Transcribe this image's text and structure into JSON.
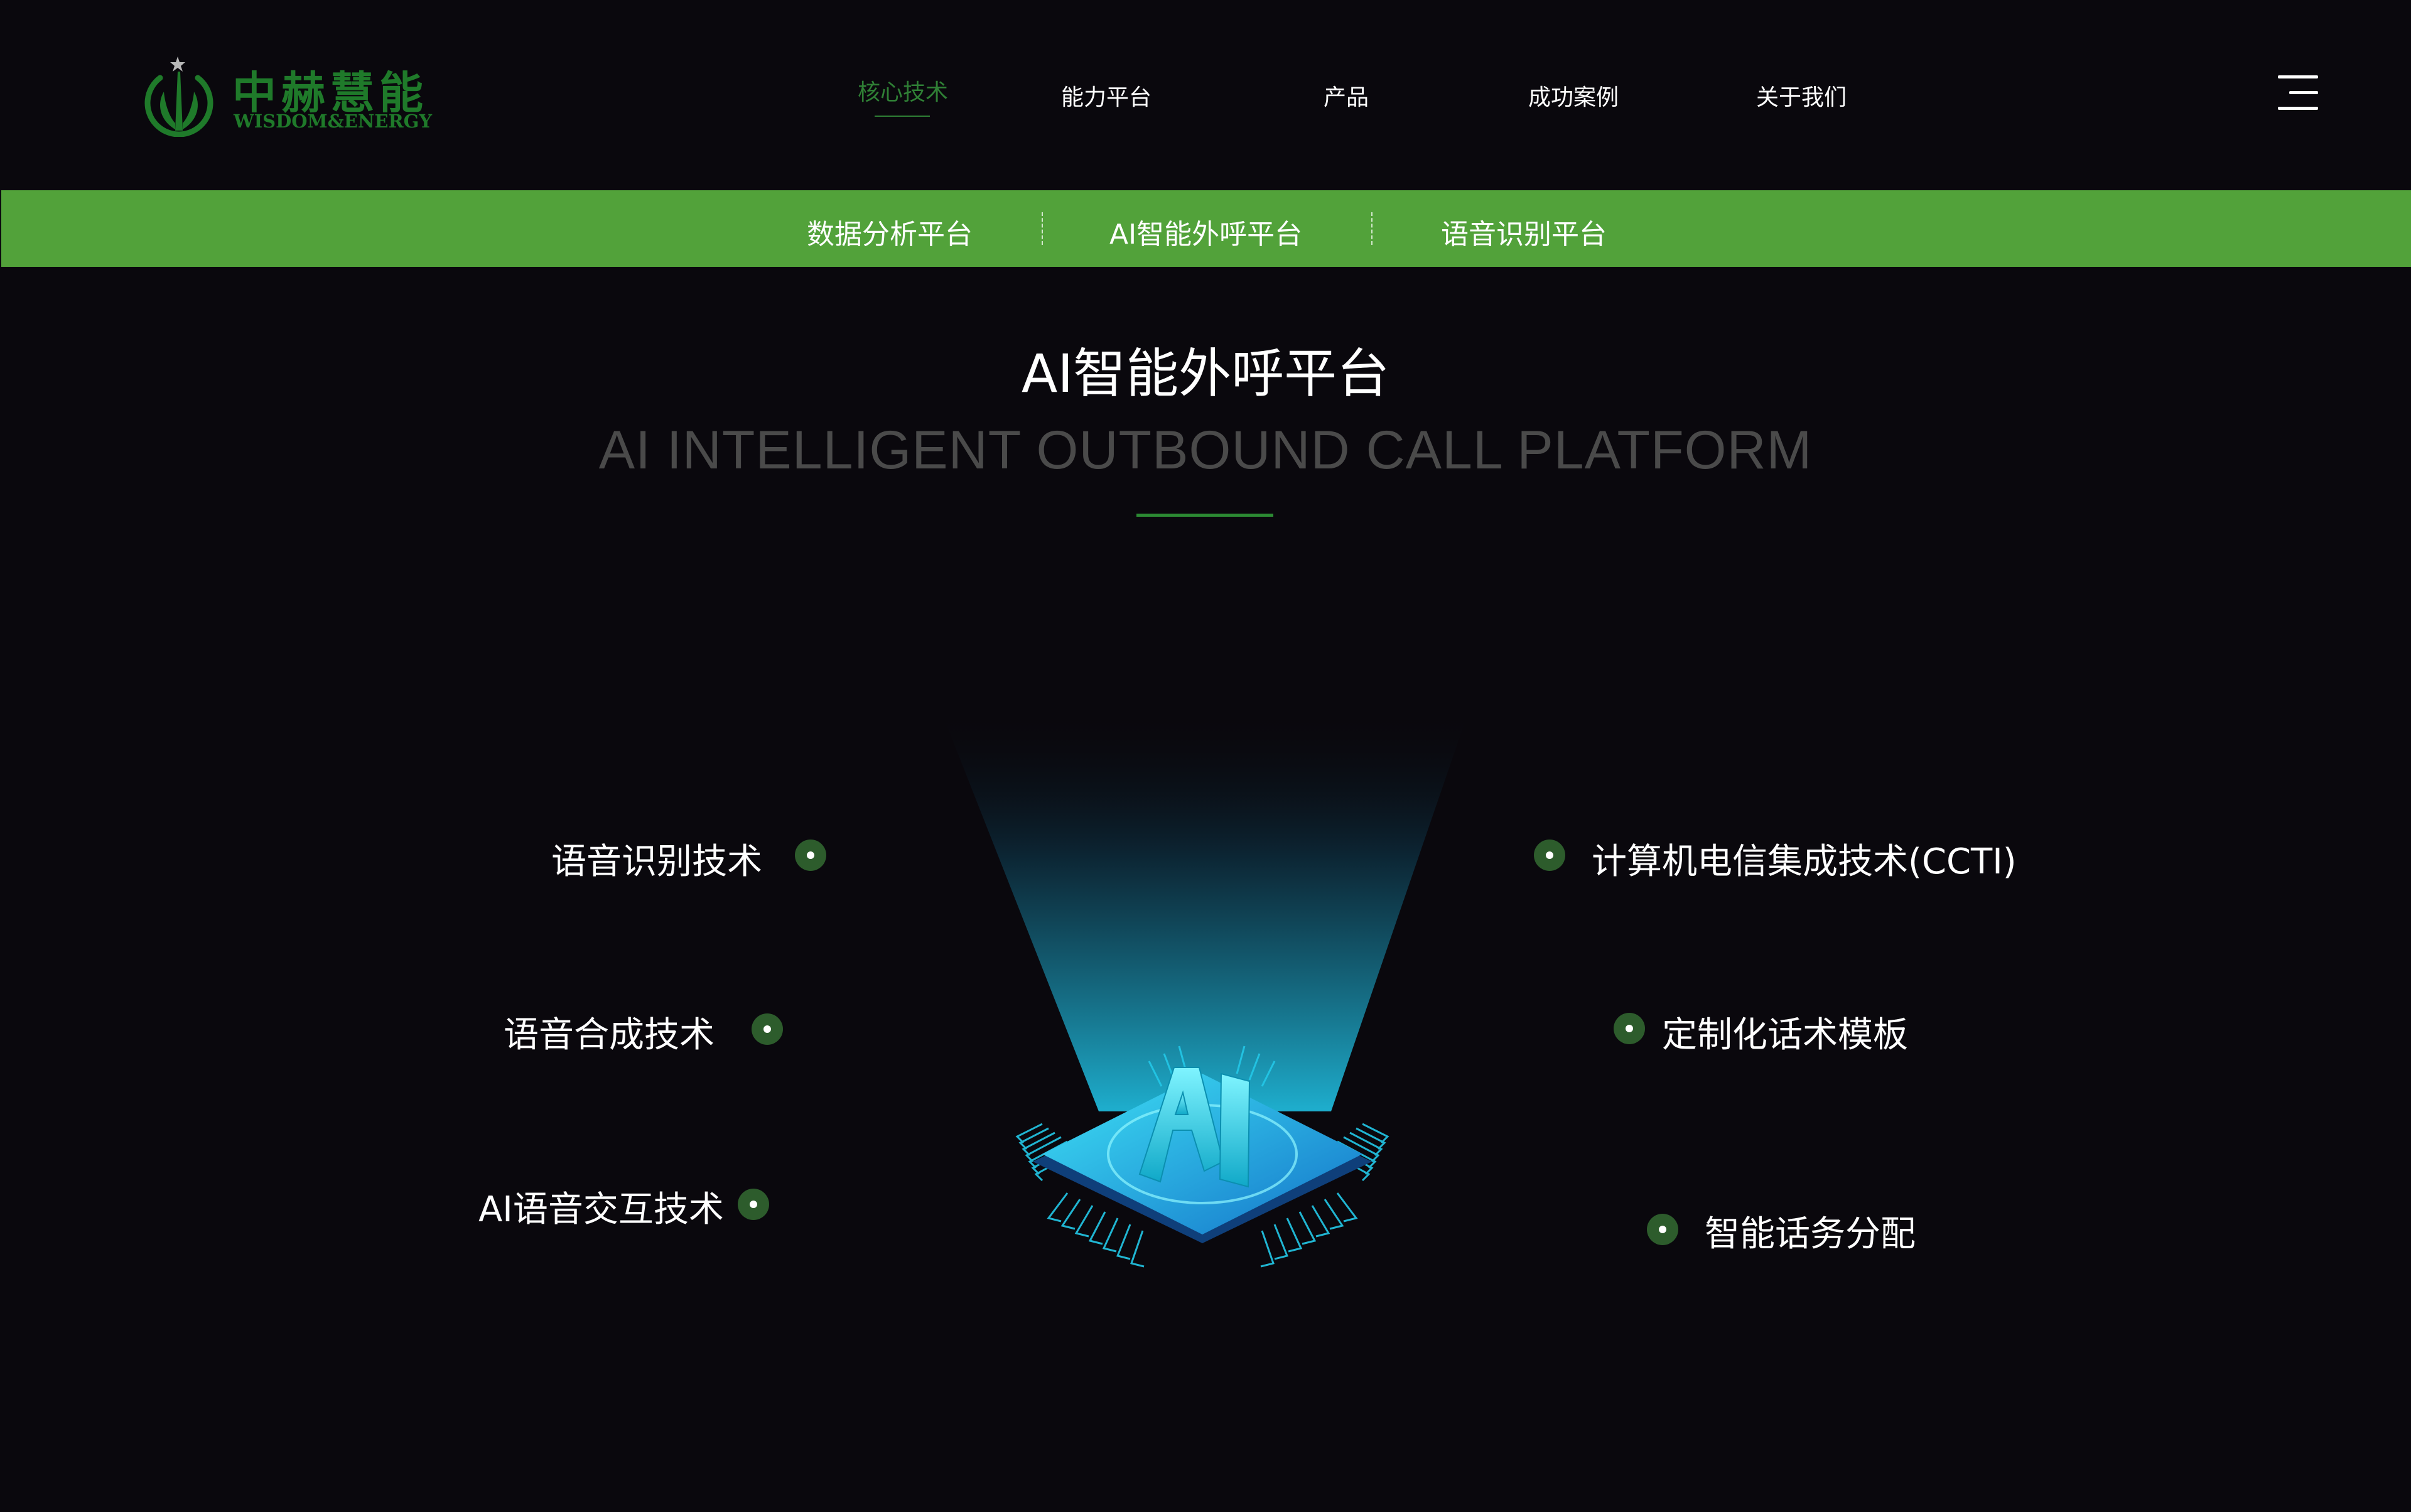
{
  "brand": {
    "name_cn": "中赫慧能",
    "name_en": "WISDOM&ENERGY",
    "color": "#1f7a2a"
  },
  "nav": {
    "items": [
      {
        "label": "核心技术",
        "active": true
      },
      {
        "label": "能力平台",
        "active": false
      },
      {
        "label": "产品",
        "active": false
      },
      {
        "label": "成功案例",
        "active": false
      },
      {
        "label": "关于我们",
        "active": false
      }
    ],
    "menu_icon": "hamburger-menu-icon",
    "active_color": "#2f7f35"
  },
  "subnav": {
    "background": "#52a23a",
    "items": [
      {
        "label": "数据分析平台"
      },
      {
        "label": "AI智能外呼平台"
      },
      {
        "label": "语音识别平台"
      }
    ]
  },
  "section": {
    "title": "AI智能外呼平台",
    "subtitle": "AI INTELLIGENT OUTBOUND CALL PLATFORM",
    "accent": "#2c8a33"
  },
  "features": {
    "left": [
      {
        "label": "语音识别技术"
      },
      {
        "label": "语音合成技术"
      },
      {
        "label": "AI语音交互技术"
      }
    ],
    "right": [
      {
        "label": "计算机电信集成技术(CCTI)"
      },
      {
        "label": "定制化话术模板"
      },
      {
        "label": "智能话务分配"
      }
    ],
    "bullet_color": "#2d5c2c",
    "bullet_icon": "dot-bullet-icon"
  },
  "illustration": {
    "chip_text": "AI",
    "icon": "ai-chip-icon",
    "glow_color": "#1fc8e8"
  }
}
